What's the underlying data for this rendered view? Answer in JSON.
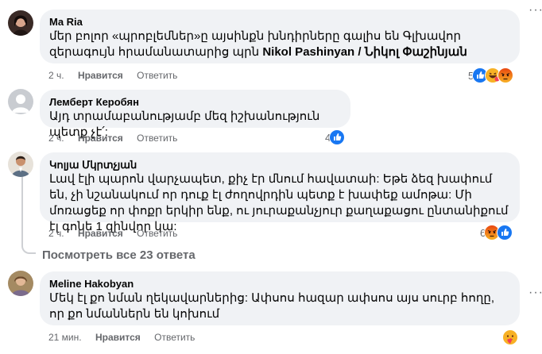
{
  "comments": [
    {
      "author": "Ma Ria",
      "text_before": "մեր բոլոր «պրոբլեմներ»ը այսինքն խնդիրները գալիս են Գլխավոր զերագույն հրամանատարից պրն ",
      "text_bold": "Nikol Pashinyan / Նիկոլ Փաշինյան",
      "time": "2 ч.",
      "like_label": "Нравится",
      "reply_label": "Ответить",
      "reaction_count": "5"
    },
    {
      "author": "Лемберт Керобян",
      "text": "Այդ տրամաբանությամբ մեզ իշխանություն պետք չէ՛:",
      "time": "2 ч.",
      "like_label": "Нравится",
      "reply_label": "Ответить",
      "reaction_count": "4"
    },
    {
      "author": "Կոլյա Մկրտչյան",
      "text": "Լավ էլի պարոն վարչապետ, քիչ էր մնում հավատաի: Եթե ձեզ խափում են, չի նշանակում որ դուք էլ ժողովրդին պետք է խափեք ամոթա: Մի մոռացեք որ փոքր երկիր ենք, ու յուրաքանչյուր քաղաքացու ընտանիքում էլ գոնե 1 զինվոր կա:",
      "time": "2 ч.",
      "like_label": "Нравится",
      "reply_label": "Ответить",
      "reaction_count": "6"
    },
    {
      "author": "Meline Hakobyan",
      "text": "Մեկ էլ քո նման ղեկավարներից: Ափսոս հազար ափսոս այս սուրբ հողը, որ քո նմաններն են կոխում",
      "time": "21 мин.",
      "like_label": "Нравится",
      "reply_label": "Ответить"
    }
  ],
  "view_more_replies": "Посмотреть все 23 ответа",
  "colors": {
    "like": "#1877f2",
    "love": "#f33e58",
    "angry": "#e9710f",
    "haha": "#f7b125",
    "bubble": "#f0f2f5",
    "meta": "#65676b"
  }
}
